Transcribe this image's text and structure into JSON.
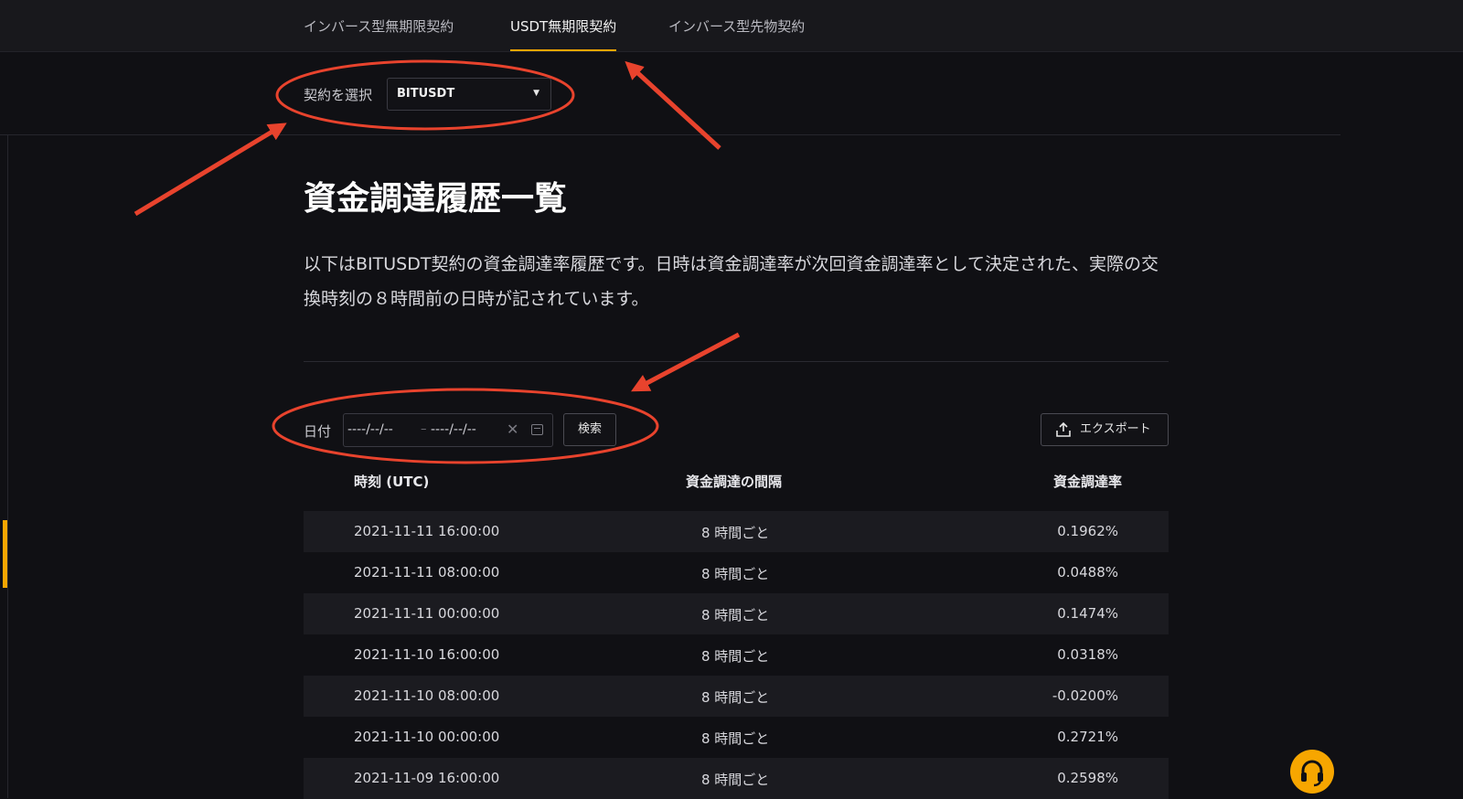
{
  "tabs": [
    {
      "label": "インバース型無期限契約"
    },
    {
      "label": "USDT無期限契約"
    },
    {
      "label": "インバース型先物契約"
    }
  ],
  "contract_select": {
    "label": "契約を選択",
    "value": "BITUSDT"
  },
  "page_title": "資金調達履歴一覧",
  "description": "以下はBITUSDT契約の資金調達率履歴です。日時は資金調達率が次回資金調達率として決定された、実際の交換時刻の８時間前の日時が記されています。",
  "filter": {
    "date_label": "日付",
    "start_placeholder": "----/--/--",
    "separator": "–",
    "end_placeholder": "----/--/--",
    "search_label": "検索",
    "export_label": "エクスポート"
  },
  "table": {
    "headers": [
      "時刻 (UTC)",
      "資金調達の間隔",
      "資金調達率"
    ],
    "rows": [
      [
        "2021-11-11 16:00:00",
        "8 時間ごと",
        "0.1962%"
      ],
      [
        "2021-11-11 08:00:00",
        "8 時間ごと",
        "0.0488%"
      ],
      [
        "2021-11-11 00:00:00",
        "8 時間ごと",
        "0.1474%"
      ],
      [
        "2021-11-10 16:00:00",
        "8 時間ごと",
        "0.0318%"
      ],
      [
        "2021-11-10 08:00:00",
        "8 時間ごと",
        "-0.0200%"
      ],
      [
        "2021-11-10 00:00:00",
        "8 時間ごと",
        "0.2721%"
      ],
      [
        "2021-11-09 16:00:00",
        "8 時間ごと",
        "0.2598%"
      ]
    ]
  },
  "colors": {
    "accent": "#f7a600",
    "annotation": "#e8432d",
    "background": "#101014"
  }
}
